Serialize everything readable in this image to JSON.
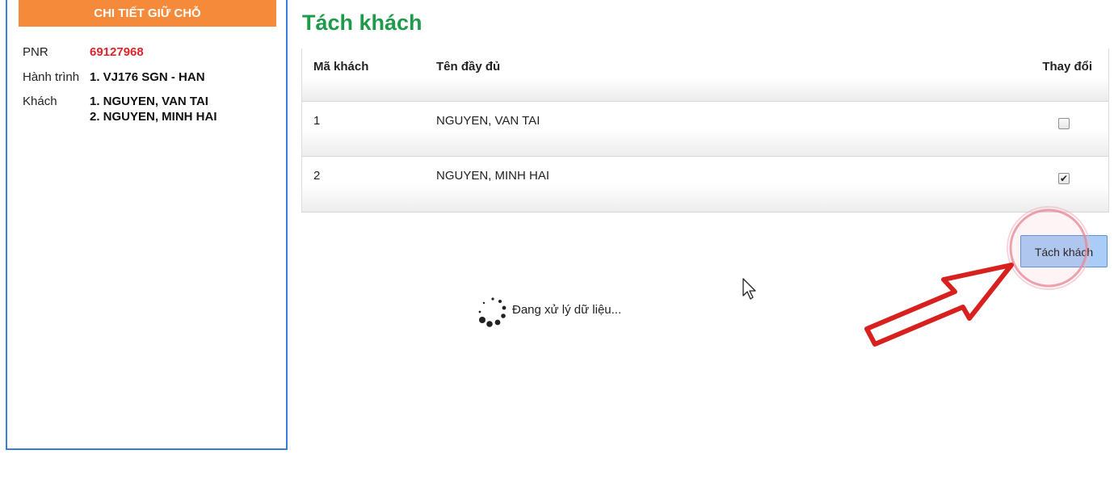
{
  "panel": {
    "header": "CHI TIẾT GIỮ CHỖ",
    "pnr_label": "PNR",
    "pnr_value": "69127968",
    "route_label": "Hành trình",
    "route_value": "1. VJ176 SGN - HAN",
    "pax_label": "Khách",
    "pax": [
      "1. NGUYEN, VAN TAI",
      "2. NGUYEN, MINH HAI"
    ]
  },
  "main": {
    "title": "Tách khách",
    "table": {
      "headers": [
        "Mã khách",
        "Tên đầy đủ",
        "Thay đổi"
      ],
      "rows": [
        {
          "id": "1",
          "name": "NGUYEN, VAN TAI",
          "checked": false
        },
        {
          "id": "2",
          "name": "NGUYEN, MINH HAI",
          "checked": true
        }
      ]
    },
    "split_button": "Tách khách",
    "loading_text": "Đang xử lý dữ liệu..."
  },
  "icons": {
    "checkmark": "✔",
    "cursor": "cursor-icon",
    "spinner": "spinner-icon",
    "arrow": "annotation-arrow-icon"
  },
  "colors": {
    "header_orange": "#f58a3b",
    "title_green": "#1f9a4a",
    "pnr_red": "#e0242b",
    "panel_border": "#3b7dd8"
  }
}
